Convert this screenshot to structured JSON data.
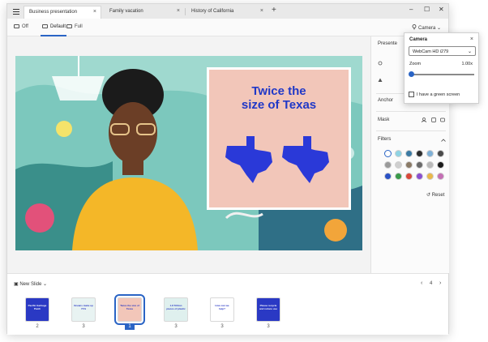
{
  "tabs": [
    {
      "label": "Business presentation",
      "close": "×",
      "active": true
    },
    {
      "label": "Family vacation",
      "close": "×",
      "active": false
    },
    {
      "label": "History of California",
      "close": "×",
      "active": false
    }
  ],
  "new_tab_label": "+",
  "window_controls": {
    "minimize": "–",
    "maximize": "☐",
    "close": "✕"
  },
  "toolbar": {
    "modes": [
      {
        "label": "Off",
        "active": false
      },
      {
        "label": "Default",
        "active": true
      },
      {
        "label": "Full",
        "active": false
      }
    ],
    "camera_label": "Camera",
    "camera_chevron": "⌄"
  },
  "slide": {
    "title_line1": "Twice the",
    "title_line2": "size of Texas"
  },
  "panel": {
    "presenter_label": "Presente",
    "anchor_label": "Anchor",
    "mask_label": "Mask",
    "filters_label": "Filters",
    "reset_label": "Reset",
    "filter_swatches": [
      "#ffffff",
      "#8fd3e3",
      "#3b7aa3",
      "#2d2d2d",
      "#7fb0d6",
      "#4a4a4a",
      "#9a9a9a",
      "#cfcfcf",
      "#8a7a66",
      "#6a6a6a",
      "#b9b9b9",
      "#1a1a1a",
      "#2a52c5",
      "#3a9a4a",
      "#d9483a",
      "#8a4fd0",
      "#e9b84a",
      "#c46fb4"
    ]
  },
  "camera_popup": {
    "title": "Camera",
    "close": "×",
    "device": "WebCam HD i279",
    "zoom_label": "Zoom",
    "zoom_value": "1.00x",
    "zoom_level": 0.0,
    "green_screen_label": "I have a green screen",
    "green_screen_checked": false
  },
  "filmstrip": {
    "new_slide_label": "New Slide",
    "page_number": "4",
    "prev": "‹",
    "next": "›",
    "thumbnails": [
      {
        "text": "Pacific Garbage Patch",
        "count": "2",
        "bg": "#2a39c4",
        "fg": "#ffffff",
        "selected": false
      },
      {
        "text": "Oceans make up 71%",
        "count": "3",
        "bg": "#e8f3f2",
        "fg": "#2a39c4",
        "selected": false
      },
      {
        "text": "Twice the size of Texas",
        "count": "1",
        "bg": "#f2c6b9",
        "fg": "#2a39c4",
        "selected": true
      },
      {
        "text": "1.8 Trillion pieces of plastic",
        "count": "3",
        "bg": "#dff0ee",
        "fg": "#2a39c4",
        "selected": false
      },
      {
        "text": "How can we help?",
        "count": "3",
        "bg": "#ffffff",
        "fg": "#2a39c4",
        "selected": false
      },
      {
        "text": "Please recycle and reduce use",
        "count": "3",
        "bg": "#2a39c4",
        "fg": "#ffffff",
        "selected": false
      }
    ]
  }
}
